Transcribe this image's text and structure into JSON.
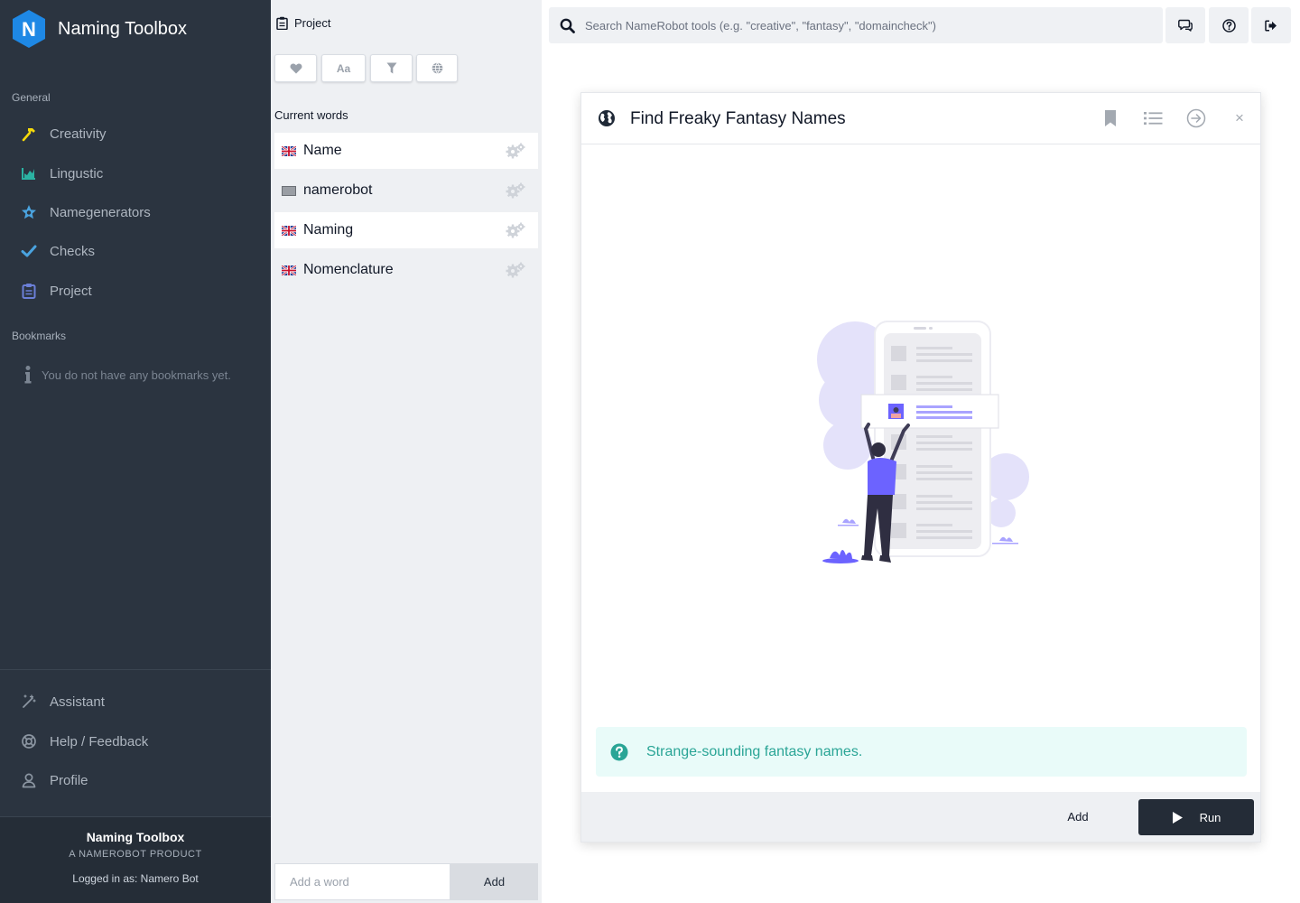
{
  "sidebar": {
    "brand_title": "Naming Toolbox",
    "brand_letter": "N",
    "general_label": "General",
    "items": [
      {
        "label": "Creativity",
        "icon": "hammer-icon",
        "color": "#f5d90a"
      },
      {
        "label": "Lingustic",
        "icon": "bar-chart-icon",
        "color": "#2bb3a3"
      },
      {
        "label": "Namegenerators",
        "icon": "star-badge-icon",
        "color": "#4aa3df"
      },
      {
        "label": "Checks",
        "icon": "checkmark-icon",
        "color": "#4aa3df"
      },
      {
        "label": "Project",
        "icon": "clipboard-icon",
        "color": "#6b7fd7"
      }
    ],
    "bookmarks_label": "Bookmarks",
    "bookmarks_empty": "You do not have any bookmarks yet.",
    "bottom_items": [
      {
        "label": "Assistant",
        "icon": "magic-wand-icon"
      },
      {
        "label": "Help / Feedback",
        "icon": "lifebuoy-icon"
      },
      {
        "label": "Profile",
        "icon": "user-icon"
      }
    ],
    "footer": {
      "title": "Naming Toolbox",
      "subtitle": "A NAMEROBOT PRODUCT",
      "logged_in": "Logged in as: Namero Bot"
    }
  },
  "project": {
    "header": "Project",
    "toolbar": [
      {
        "icon": "heart-icon"
      },
      {
        "icon": "font-case-icon",
        "label": "Aa"
      },
      {
        "icon": "filter-icon"
      },
      {
        "icon": "globe-icon"
      }
    ],
    "current_words_label": "Current words",
    "words": [
      {
        "text": "Name",
        "flag": "uk-flag-icon"
      },
      {
        "text": "namerobot",
        "flag": "generic-flag-icon"
      },
      {
        "text": "Naming",
        "flag": "uk-flag-icon"
      },
      {
        "text": "Nomenclature",
        "flag": "uk-flag-icon"
      }
    ],
    "add_placeholder": "Add a word",
    "add_label": "Add"
  },
  "topbar": {
    "search_placeholder": "Search NameRobot tools (e.g. \"creative\", \"fantasy\", \"domaincheck\")",
    "buttons": [
      "chat-icon",
      "help-circle-icon",
      "logout-icon"
    ]
  },
  "dialog": {
    "title": "Find Freaky Fantasy Names",
    "header_buttons": [
      "bookmark-icon",
      "list-icon",
      "arrow-circle-icon",
      "close-icon"
    ],
    "close_symbol": "×",
    "info_text": "Strange-sounding fantasy names.",
    "add_label": "Add",
    "run_label": "Run",
    "accent": "#2aa596"
  }
}
